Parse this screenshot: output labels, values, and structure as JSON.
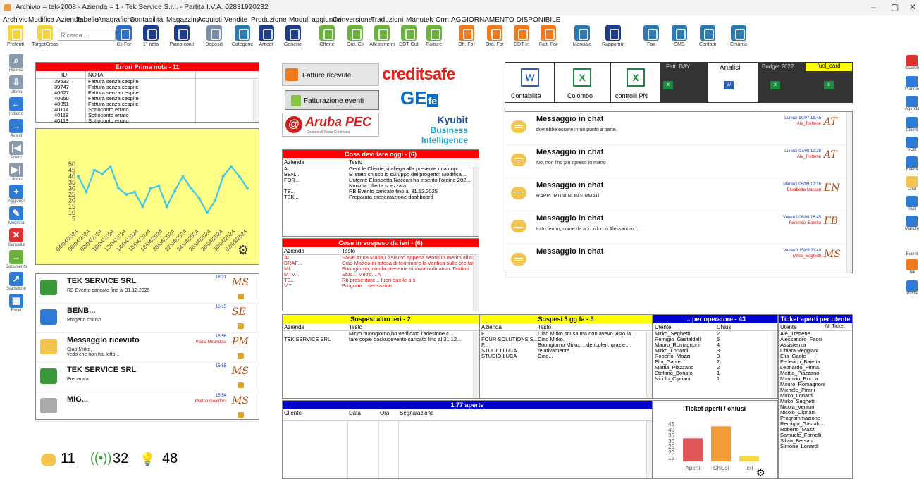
{
  "window": {
    "title": "Archivio = tek-2008 - Azienda = 1 - Tek Service S.r.l. - Partita I.V.A. 02831920232",
    "min": "–",
    "max": "▢",
    "close": "✕"
  },
  "menu": [
    "Archivio",
    "Modifica",
    "Aziende",
    "Tabelle",
    "Anagrafiche",
    "Contabilità",
    "Magazzino",
    "Acquisti",
    "Vendite",
    "Produzione",
    "Moduli aggiuntivi",
    "Conversione",
    "Traduzioni",
    "Manutek",
    "Crm",
    "AGGIORNAMENTO DISPONIBILE"
  ],
  "toolbar": {
    "search_placeholder": "Ricerca ...",
    "buttons": [
      "Preferiti",
      "TargetCross",
      "Cli-For",
      "1° nota",
      "Piano conti",
      "Depositi",
      "Categorie",
      "Articoli",
      "Generici",
      "Offerte",
      "Ord. Cli",
      "Allestimenti",
      "DDT Out",
      "Fatture",
      "Off. For",
      "Ord. For",
      "DDT In",
      "Fatt. For",
      "Manuale",
      "Rapportini",
      "Fax",
      "SMS",
      "Contatti",
      "Chiama"
    ]
  },
  "leftnav": [
    "Ricerca",
    "Ultimo",
    "Indietro",
    "Avanti",
    "Primo",
    "Ultimo",
    "Aggiungi",
    "Modifica",
    "Cancella",
    "Documento",
    "Statistiche",
    "Excel"
  ],
  "rightnav": [
    "Scadenze",
    "Planning",
    "Agenda",
    "Clienti",
    "SCM",
    "Eventi",
    "Chat",
    "Invia",
    "Manutek",
    "Eventi",
    "Tek",
    "Posta"
  ],
  "errori": {
    "title": "Errori Prima nota - 11",
    "col_id": "ID",
    "col_nota": "NOTA",
    "rows": [
      {
        "id": "39633",
        "nota": "Fattura senza cespite"
      },
      {
        "id": "39747",
        "nota": "Fattura senza cespite"
      },
      {
        "id": "40027",
        "nota": "Fattura senza cespite"
      },
      {
        "id": "40050",
        "nota": "Fattura senza cespite"
      },
      {
        "id": "40051",
        "nota": "Fattura senza cespite"
      },
      {
        "id": "40114",
        "nota": "Sottoconto errato"
      },
      {
        "id": "40118",
        "nota": "Sottoconto errato"
      },
      {
        "id": "40119",
        "nota": "Sottoconto errato"
      }
    ]
  },
  "chart_data": {
    "type": "line",
    "x": [
      "04/04/2024",
      "06/04/2024",
      "08/04/2024",
      "10/04/2024",
      "12/04/2024",
      "14/04/2024",
      "16/04/2024",
      "18/04/2024",
      "20/04/2024",
      "22/04/2024",
      "24/04/2024",
      "26/04/2024",
      "28/04/2024",
      "30/04/2024",
      "02/05/2024"
    ],
    "values": [
      40,
      27,
      45,
      42,
      48,
      30,
      25,
      27,
      15,
      30,
      32,
      15,
      28,
      40,
      30,
      22,
      10,
      20,
      40,
      48,
      40,
      30
    ],
    "ylim": [
      0,
      50
    ],
    "yticks": [
      5,
      10,
      15,
      20,
      25,
      30,
      35,
      40,
      45,
      50
    ],
    "grid": false,
    "color": "#3fc8e8"
  },
  "quick": {
    "fatture_ricevute": "Fatture ricevute",
    "fatturazione_eventi": "Fatturazione eventi",
    "creditsafe": "creditsafe",
    "gefe_g": "GE",
    "gefe_fe": "fe",
    "aruba": "Aruba PEC",
    "aruba_sub": "Gestore di Posta Certificata",
    "kyubit1": "Kyubit",
    "kyubit2": "Business Intelligence"
  },
  "office": {
    "contabilita": "Contabilità",
    "colombo": "Colombo",
    "controlli": "controlli PN",
    "fatt_day": "Fatt. DAY",
    "analisi": "Analisi",
    "budget": "Budget 2022",
    "fuel": "fuel_card"
  },
  "chat": [
    {
      "title": "Messaggio in chat",
      "text": "dovrebbe essere in un punto a parte.",
      "date": "Lunedì 10/07 16:45",
      "user": "Ale_Trettene",
      "init": "AT"
    },
    {
      "title": "Messaggio in chat",
      "text": "No, non l'ho più ripreso in mano",
      "date": "Lunedì 07/08 12:28",
      "user": "Ale_Trettene",
      "init": "AT"
    },
    {
      "title": "Messaggio in chat",
      "text": "RAPPORTINI NON FIRMATI",
      "date": "Martedì 05/09 12:16",
      "user": "Elisabetta Naccari",
      "init": "EN"
    },
    {
      "title": "Messaggio in chat",
      "text": "tutto fermo, come da accordi con Alessandro...",
      "date": "Venerdì 08/09 16:45",
      "user": "Federico_Baietta",
      "init": "FB"
    },
    {
      "title": "Messaggio in chat",
      "text": "",
      "date": "Venerdì 15/09 11:49",
      "user": "Mirko_Seghetti",
      "init": "MS"
    }
  ],
  "feed": [
    {
      "title": "TEK SERVICE SRL",
      "text": "RB  Evento caricato fino al 31.12.2025",
      "time": "18:31",
      "init": "MS",
      "user": ""
    },
    {
      "title": "BENB...",
      "text": "Progetto chiuso",
      "time": "16:15",
      "init": "SE",
      "user": ""
    },
    {
      "title": "Messaggio ricevuto",
      "text": "Ciao Mirko,\nvedo che non hai letto...",
      "time": "15:56",
      "init": "PM",
      "user": "Paola Mirandola"
    },
    {
      "title": "TEK SERVICE SRL",
      "text": "Preparata",
      "time": "15:55",
      "init": "MS",
      "user": ""
    },
    {
      "title": "MIG...",
      "text": "",
      "time": "15:54",
      "init": "MS",
      "user": "Matteo Gualdoni"
    }
  ],
  "counters": {
    "chat": "11",
    "signal": "32",
    "bulb": "48"
  },
  "oggi": {
    "title": "Cosa devi fare oggi - (6)",
    "col1": "Azienda",
    "col2": "Testo",
    "rows": [
      {
        "a": "A",
        "t": "Gent.le Cliente,si allega alla presente una copi..."
      },
      {
        "a": "BEN...",
        "t": "E' stato chiuso lo sviluppo del progetto: Modifica..."
      },
      {
        "a": "FOR...",
        "t": "L'utente Elisabetta Naccari ha inserito l'ordine 202..."
      },
      {
        "a": "...",
        "t": "Nuovba offerta spezzata"
      },
      {
        "a": "TE...",
        "t": "RB Evento caricato fino al 31.12.2025"
      },
      {
        "a": "TEK...",
        "t": "Preparata presentazione dashboard"
      }
    ]
  },
  "ieri": {
    "title": "Cose in sospeso da ieri - (6)",
    "col1": "Azienda",
    "col2": "Testo",
    "rows": [
      {
        "a": "AL...",
        "t": "Salve Anna Maria,Ci siamo appena sentiti in merito all'azi"
      },
      {
        "a": "BRAF...",
        "t": "Ciao Matteo,in attesa di terminare la verifica sulle ore fat"
      },
      {
        "a": "MI...",
        "t": "Buongiorno, con la presente si invia ordinativo. Distinti"
      },
      {
        "a": "MTV...",
        "t": "Stuc... Metro... A"
      },
      {
        "a": "TE...",
        "t": "Rb presentate... fuori quelle a s"
      },
      {
        "a": "V.T...",
        "t": "Program... sensazion"
      }
    ]
  },
  "altroieri": {
    "title": "Sospesi altro ieri - 2",
    "col1": "Azienda",
    "col2": "Testo",
    "rows": [
      {
        "a": "...",
        "t": "Mirko buongiorno,ho verificato l'adesione c..."
      },
      {
        "a": "TEK SERVICE SRL",
        "t": "fare copie backupevento caricato fino al 31.12..."
      }
    ]
  },
  "tregg": {
    "title": "Sospesi 3 gg fa - 5",
    "col1": "Azienda",
    "col2": "Testo",
    "rows": [
      {
        "a": "F...",
        "t": "Ciao Mirko,scusa ma non avevo visto la..."
      },
      {
        "a": "FOUR SOLUTIONS S...",
        "t": "Ciao Mirko,"
      },
      {
        "a": "F...",
        "t": "Buongiorno Mirko, ...dericoleri, grazie..."
      },
      {
        "a": "STUDIO LUCA",
        "t": "relativamente..."
      },
      {
        "a": "STUDIO LUCA",
        "t": "Ciao..."
      }
    ]
  },
  "operatore": {
    "title": "... per operatore - 43",
    "col1": "Utente",
    "col2": "Chiusi",
    "rows": [
      {
        "u": "Mirko_Seghetti",
        "c": "2"
      },
      {
        "u": "Remigio_Gastaldelli",
        "c": "5"
      },
      {
        "u": "Mauro_Romagnoni",
        "c": "4"
      },
      {
        "u": "Mirko_Lonardi",
        "c": "3"
      },
      {
        "u": "Roberto_Mazzi",
        "c": "3"
      },
      {
        "u": "Elia_Gaole",
        "c": "2"
      },
      {
        "u": "Mattia_Piazzano",
        "c": "2"
      },
      {
        "u": "Stefano_Bonato",
        "c": "1"
      },
      {
        "u": "Nicolo_Cipriani",
        "c": "1"
      }
    ]
  },
  "ticket": {
    "title": "Ticket aperti per utente",
    "col1": "Utente",
    "col2": "Nr Ticket",
    "rows": [
      "Ale_Trettene",
      "Alessandro_Facci",
      "Assistenza",
      "Chiara Reggiani",
      "Elia_Gaole",
      "Federico_Baietta",
      "Leonardo_Pinna",
      "Mattia_Piazzano",
      "Maurizio_Rocca",
      "Mauro_Romagnoni",
      "Michele_Pirani",
      "Mirko_Lonardi",
      "Mirko_Seghetti",
      "Nicola_Venturi",
      "Nicolo_Cipriani",
      "Programmazione",
      "Remigio_Gastald...",
      "Roberto_Mazzi",
      "Samuele_Fornelli",
      "Silvia_Bersani",
      "Simone_Lonardi"
    ]
  },
  "aperte": {
    "title": "1.77 aperte",
    "cols": [
      "Cliente",
      "Data",
      "Ora",
      "Segnalazione"
    ]
  },
  "tchart": {
    "title": "Ticket aperti / chiusi",
    "categories": [
      "Aperti",
      "Chiusi",
      "Ieri"
    ],
    "values": [
      30,
      42,
      12
    ],
    "yticks": [
      "45",
      "40",
      "35",
      "30",
      "25",
      "20",
      "15"
    ],
    "colors": [
      "#e05555",
      "#f39a3a",
      "#f6d84a"
    ]
  }
}
